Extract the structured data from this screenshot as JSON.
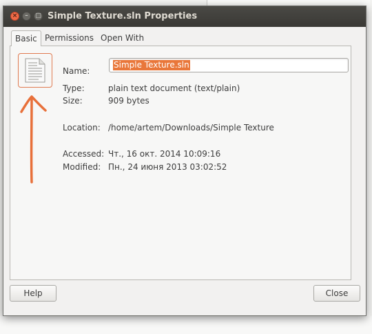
{
  "window": {
    "title": "Simple Texture.sln Properties",
    "controls": {
      "close": "×",
      "minimize": "–",
      "maximize": "□"
    }
  },
  "tabs": [
    {
      "label": "Basic",
      "active": true
    },
    {
      "label": "Permissions",
      "active": false
    },
    {
      "label": "Open With",
      "active": false
    }
  ],
  "basic": {
    "icon": "text-document-icon",
    "name_label": "Name:",
    "name_value": "Simple Texture.sln",
    "type_label": "Type:",
    "type_value": "plain text document (text/plain)",
    "size_label": "Size:",
    "size_value": "909 bytes",
    "location_label": "Location:",
    "location_value": "/home/artem/Downloads/Simple Texture",
    "accessed_label": "Accessed:",
    "accessed_value": "Чт., 16 окт. 2014 10:09:16",
    "modified_label": "Modified:",
    "modified_value": "Пн., 24 июня 2013 03:02:52"
  },
  "buttons": {
    "help": "Help",
    "close": "Close"
  },
  "colors": {
    "accent": "#e9773a",
    "titlebar": "#3c3b37",
    "annotation": "#e8703a"
  }
}
